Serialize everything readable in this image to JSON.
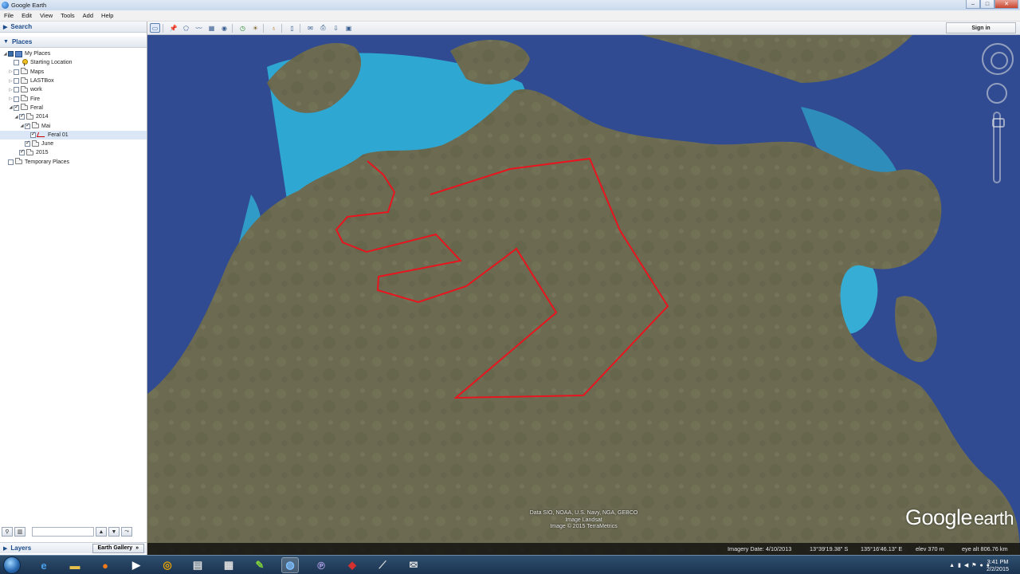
{
  "window": {
    "title": "Google Earth"
  },
  "menu": [
    "File",
    "Edit",
    "View",
    "Tools",
    "Add",
    "Help"
  ],
  "search_panel": {
    "title": "Search"
  },
  "places_panel": {
    "title": "Places",
    "tree": [
      {
        "label": "My Places",
        "indent": 0,
        "state": "expanded",
        "check": "checked",
        "icon": "myplaces-icon"
      },
      {
        "label": "Starting Location",
        "indent": 1,
        "state": "leaf",
        "check": "unchecked",
        "icon": "placemark-icon"
      },
      {
        "label": "Maps",
        "indent": 1,
        "state": "collapsed",
        "check": "unchecked",
        "icon": "folder-icon"
      },
      {
        "label": "LASTBox",
        "indent": 1,
        "state": "collapsed",
        "check": "unchecked",
        "icon": "folder-icon"
      },
      {
        "label": "work",
        "indent": 1,
        "state": "collapsed",
        "check": "unchecked",
        "icon": "folder-icon"
      },
      {
        "label": "Fire",
        "indent": 1,
        "state": "collapsed",
        "check": "unchecked",
        "icon": "folder-icon"
      },
      {
        "label": "Feral",
        "indent": 1,
        "state": "expanded",
        "check": "checked",
        "icon": "folder-icon"
      },
      {
        "label": "2014",
        "indent": 2,
        "state": "expanded",
        "check": "checked",
        "icon": "folder-icon"
      },
      {
        "label": "Mai",
        "indent": 3,
        "state": "expanded",
        "check": "checked",
        "icon": "folder-icon"
      },
      {
        "label": "Feral 01",
        "indent": 4,
        "state": "leaf",
        "check": "checked",
        "icon": "path-icon",
        "selected": true
      },
      {
        "label": "June",
        "indent": 3,
        "state": "leaf",
        "check": "checked",
        "icon": "folder-icon"
      },
      {
        "label": "2015",
        "indent": 2,
        "state": "leaf",
        "check": "checked",
        "icon": "folder-icon"
      },
      {
        "label": "Temporary Places",
        "indent": 0,
        "state": "leaf",
        "check": "unchecked",
        "icon": "folder-icon"
      }
    ]
  },
  "layers_panel": {
    "title": "Layers",
    "earth_gallery_label": "Earth Gallery"
  },
  "toolbar": {
    "signin_label": "Sign in"
  },
  "map": {
    "attribution": [
      "Data SIO, NOAA, U.S. Navy, NGA, GEBCO",
      "Image Landsat",
      "Image © 2015 TerraMetrics"
    ],
    "logo_google": "Google",
    "logo_earth": "earth",
    "path_color": "#e8141e",
    "ocean_color": "#304b91",
    "land_color": "#6c6b52",
    "shallow_water_color": "#2fb2d9"
  },
  "status": {
    "imagery_date": "Imagery Date: 4/10/2013",
    "latitude": "13°39'19.38\" S",
    "longitude": "135°16'46.13\" E",
    "elevation": "elev  370 m",
    "eye_altitude": "eye alt 806.76 km"
  },
  "taskbar": {
    "time": "3:41 PM",
    "date": "2/2/2015"
  }
}
